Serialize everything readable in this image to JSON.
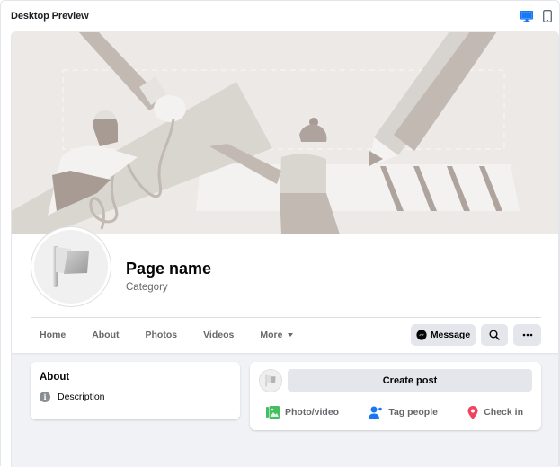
{
  "header": {
    "title": "Desktop Preview",
    "view_modes": [
      {
        "name": "desktop",
        "icon": "desktop-icon",
        "active": true,
        "color": "#1877f2"
      },
      {
        "name": "mobile",
        "icon": "mobile-icon",
        "active": false,
        "color": "#606770"
      }
    ]
  },
  "profile": {
    "page_name": "Page name",
    "category": "Category",
    "avatar_icon": "flag-icon"
  },
  "tabs": [
    {
      "label": "Home"
    },
    {
      "label": "About"
    },
    {
      "label": "Photos"
    },
    {
      "label": "Videos"
    },
    {
      "label": "More",
      "has_dropdown": true
    }
  ],
  "actions": {
    "message_label": "Message",
    "message_icon": "messenger-icon",
    "search_icon": "search-icon",
    "more_icon": "more-dots-icon"
  },
  "about": {
    "title": "About",
    "description_label": "Description",
    "icon": "info-icon"
  },
  "composer": {
    "create_post_label": "Create post",
    "actions": [
      {
        "label": "Photo/video",
        "icon": "photo-video-icon",
        "color": "#45bd62"
      },
      {
        "label": "Tag people",
        "icon": "tag-people-icon",
        "color": "#1877f2"
      },
      {
        "label": "Check in",
        "icon": "check-in-icon",
        "color": "#f3425f"
      }
    ]
  },
  "colors": {
    "accent": "#1877f2",
    "button_bg": "#e4e6eb",
    "page_bg": "#f0f2f5",
    "cover_bg": "#ece9e6"
  }
}
